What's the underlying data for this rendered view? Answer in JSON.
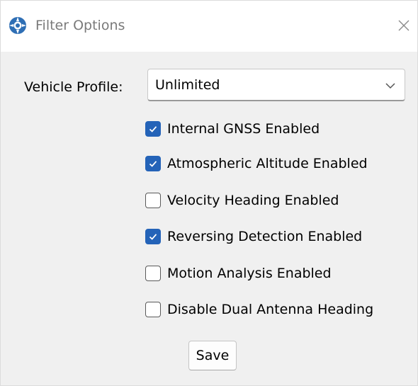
{
  "window": {
    "title": "Filter Options",
    "title_icon": "app-logo-icon",
    "close_icon": "close-icon"
  },
  "vehicle_profile": {
    "label": "Vehicle Profile:",
    "selected": "Unlimited",
    "dropdown_icon": "chevron-down-icon"
  },
  "options": [
    {
      "label": "Internal GNSS Enabled",
      "checked": true
    },
    {
      "label": "Atmospheric Altitude Enabled",
      "checked": true
    },
    {
      "label": "Velocity Heading Enabled",
      "checked": false
    },
    {
      "label": "Reversing Detection Enabled",
      "checked": true
    },
    {
      "label": "Motion Analysis Enabled",
      "checked": false
    },
    {
      "label": "Disable Dual Antenna Heading",
      "checked": false
    }
  ],
  "save_label": "Save",
  "colors": {
    "accent": "#2463b8",
    "title_text": "#7a7a7a",
    "background": "#f0f0f0",
    "titlebar": "#ffffff"
  }
}
